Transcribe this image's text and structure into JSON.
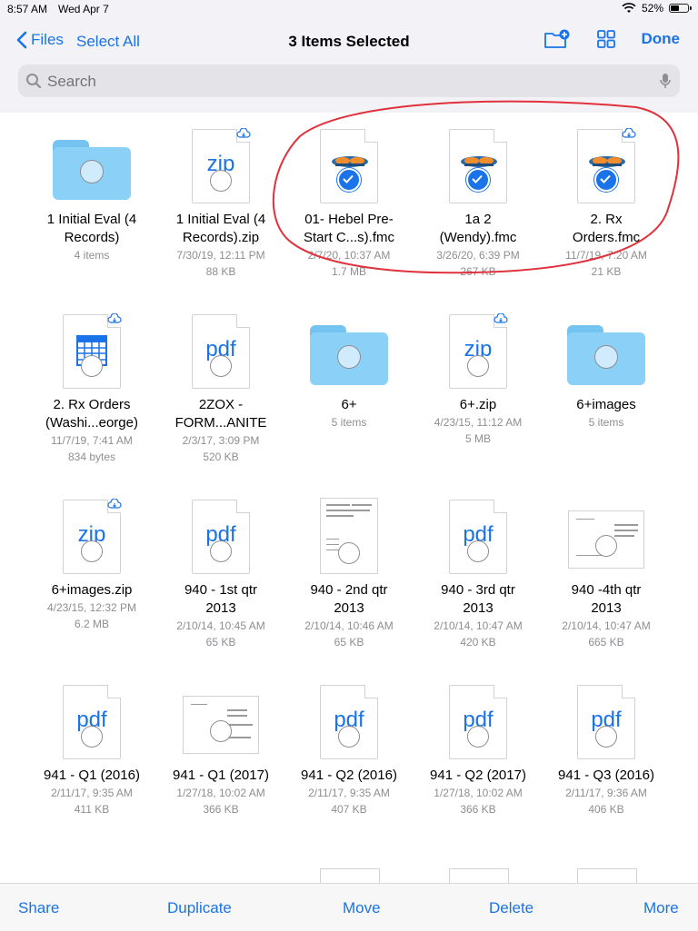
{
  "status_bar": {
    "time": "8:57 AM",
    "date": "Wed Apr 7",
    "battery": "52%"
  },
  "nav": {
    "back_label": "Files",
    "select_all": "Select All",
    "title": "3 Items Selected",
    "done": "Done"
  },
  "search": {
    "placeholder": "Search"
  },
  "items": [
    {
      "name1": "1 Initial Eval (4",
      "name2": "Records)",
      "meta1": "4 items",
      "meta2": ""
    },
    {
      "name1": "1 Initial Eval (4",
      "name2": "Records).zip",
      "meta1": "7/30/19, 12:11 PM",
      "meta2": "88 KB"
    },
    {
      "name1": "01- Hebel Pre-",
      "name2": "Start C...s).fmc",
      "meta1": "2/7/20, 10:37 AM",
      "meta2": "1.7 MB"
    },
    {
      "name1": "1a 2",
      "name2": "(Wendy).fmc",
      "meta1": "3/26/20, 6:39 PM",
      "meta2": "267 KB"
    },
    {
      "name1": "2. Rx",
      "name2": "Orders.fmc",
      "meta1": "11/7/19, 7:20 AM",
      "meta2": "21 KB"
    },
    {
      "name1": "2. Rx Orders",
      "name2": "(Washi...eorge)",
      "meta1": "11/7/19, 7:41 AM",
      "meta2": "834 bytes"
    },
    {
      "name1": "2ZOX -",
      "name2": "FORM...ANITE",
      "meta1": "2/3/17, 3:09 PM",
      "meta2": "520 KB"
    },
    {
      "name1": "6+",
      "name2": "",
      "meta1": "5 items",
      "meta2": ""
    },
    {
      "name1": "6+.zip",
      "name2": "",
      "meta1": "4/23/15, 11:12 AM",
      "meta2": "5 MB"
    },
    {
      "name1": "6+images",
      "name2": "",
      "meta1": "5 items",
      "meta2": ""
    },
    {
      "name1": "6+images.zip",
      "name2": "",
      "meta1": "4/23/15, 12:32 PM",
      "meta2": "6.2 MB"
    },
    {
      "name1": "940 - 1st qtr",
      "name2": "2013",
      "meta1": "2/10/14, 10:45 AM",
      "meta2": "65 KB"
    },
    {
      "name1": "940 - 2nd qtr",
      "name2": "2013",
      "meta1": "2/10/14, 10:46 AM",
      "meta2": "65 KB"
    },
    {
      "name1": "940 - 3rd qtr",
      "name2": "2013",
      "meta1": "2/10/14, 10:47 AM",
      "meta2": "420 KB"
    },
    {
      "name1": "940 -4th qtr",
      "name2": "2013",
      "meta1": "2/10/14, 10:47 AM",
      "meta2": "665 KB"
    },
    {
      "name1": "941 - Q1 (2016)",
      "name2": "",
      "meta1": "2/11/17, 9:35 AM",
      "meta2": "411 KB"
    },
    {
      "name1": "941 - Q1 (2017)",
      "name2": "",
      "meta1": "1/27/18, 10:02 AM",
      "meta2": "366 KB"
    },
    {
      "name1": "941 - Q2 (2016)",
      "name2": "",
      "meta1": "2/11/17, 9:35 AM",
      "meta2": "407 KB"
    },
    {
      "name1": "941 - Q2 (2017)",
      "name2": "",
      "meta1": "1/27/18, 10:02 AM",
      "meta2": "366 KB"
    },
    {
      "name1": "941 - Q3 (2016)",
      "name2": "",
      "meta1": "2/11/17, 9:36 AM",
      "meta2": "406 KB"
    }
  ],
  "thumb_labels": {
    "zip": "zip",
    "pdf": "pdf"
  },
  "toolbar": {
    "share": "Share",
    "duplicate": "Duplicate",
    "move": "Move",
    "delete": "Delete",
    "more": "More"
  },
  "colors": {
    "accent": "#1a73e8",
    "folder": "#8bd0f7",
    "annotation": "#e0323c"
  }
}
